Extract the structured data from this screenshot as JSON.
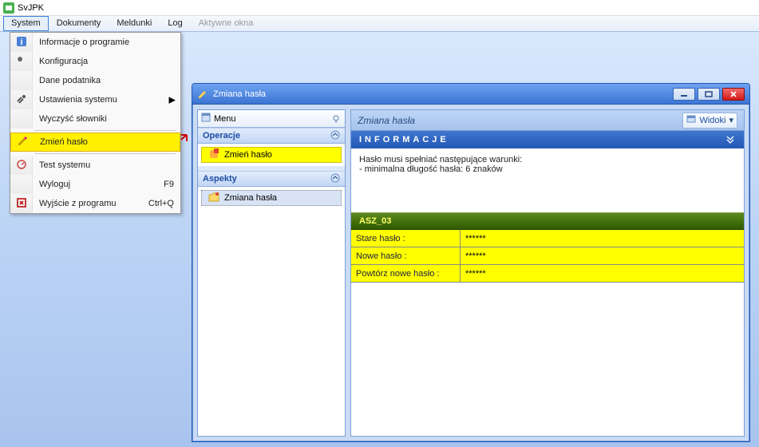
{
  "app": {
    "title": "SvJPK"
  },
  "menubar": {
    "items": [
      "System",
      "Dokumenty",
      "Meldunki",
      "Log",
      "Aktywne okna"
    ],
    "active_index": 0,
    "disabled_index": 4
  },
  "dropdown": {
    "i0": {
      "label": "Informacje o programie"
    },
    "i1": {
      "label": "Konfiguracja"
    },
    "i2": {
      "label": "Dane podatnika"
    },
    "i3": {
      "label": "Ustawienia systemu"
    },
    "i4": {
      "label": "Wyczyść słowniki"
    },
    "i5": {
      "label": "Zmień hasło"
    },
    "i6": {
      "label": "Test systemu"
    },
    "i7": {
      "label": "Wyloguj",
      "shortcut": "F9"
    },
    "i8": {
      "label": "Wyjście z programu",
      "shortcut": "Ctrl+Q"
    }
  },
  "child": {
    "title": "Zmiana hasła",
    "left": {
      "menu_label": "Menu",
      "section_ops": "Operacje",
      "op_item": "Zmień hasło",
      "section_asp": "Aspekty",
      "asp_item": "Zmiana hasła"
    },
    "right": {
      "title": "Zmiana hasła",
      "widoki_label": "Widoki",
      "info_header": "INFORMACJE",
      "info_line1": "Hasło musi spełniać następujące warunki:",
      "info_line2": " - minimalna długość hasła: 6 znaków",
      "form_header": "ASZ_03",
      "f1_label": "Stare hasło :",
      "f1_value": "******",
      "f2_label": "Nowe hasło :",
      "f2_value": "******",
      "f3_label": "Powtórz nowe hasło :",
      "f3_value": "******"
    }
  }
}
